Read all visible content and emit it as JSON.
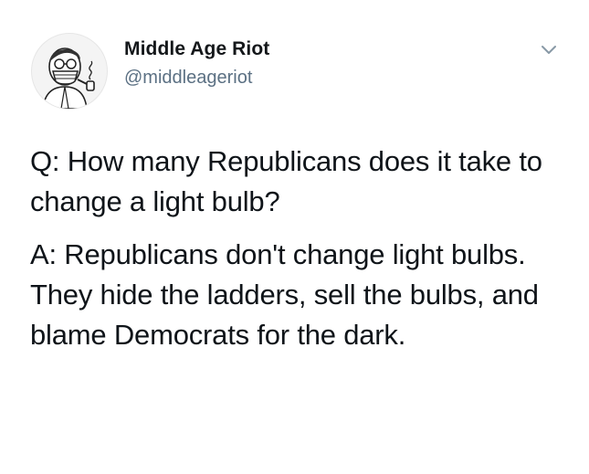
{
  "author": {
    "display_name": "Middle Age Riot",
    "handle": "@middleageriot"
  },
  "avatar_icon": "masked-man-smoking-pipe-avatar",
  "menu_icon": "chevron-down-icon",
  "tweet": {
    "question": "Q: How many Republicans does it take to change a light bulb?",
    "answer": "A: Republicans don't change light bulbs. They hide the ladders, sell the bulbs, and blame Democrats for the dark."
  },
  "colors": {
    "text": "#0f1419",
    "secondary_text": "#5b7083",
    "chevron": "#8899a6"
  }
}
